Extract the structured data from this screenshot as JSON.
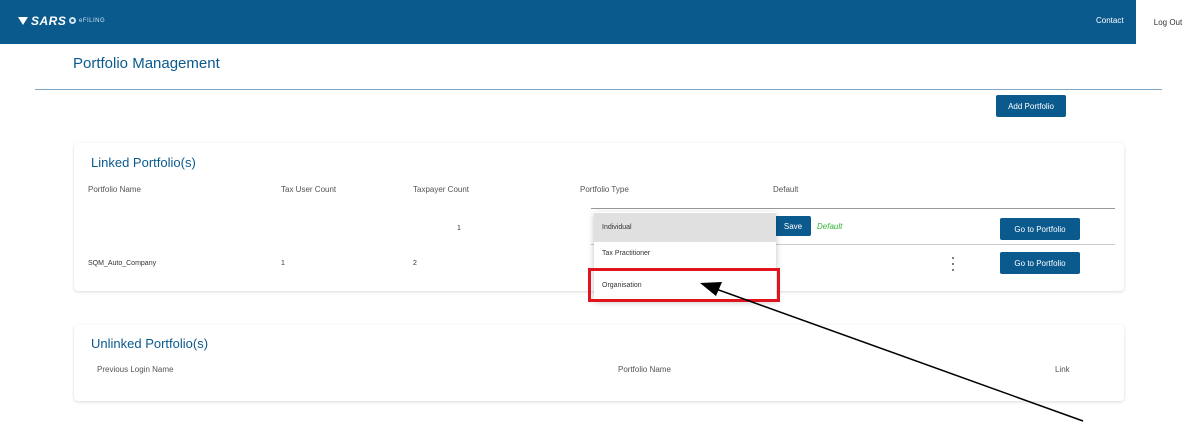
{
  "header": {
    "brand": "SARS",
    "product": "eFILING",
    "contact_label": "Contact",
    "logout_label": "Log Out"
  },
  "page": {
    "title": "Portfolio Management",
    "add_portfolio_label": "Add Portfolio"
  },
  "linked": {
    "title": "Linked Portfolio(s)",
    "columns": [
      "Portfolio Name",
      "Tax User Count",
      "Taxpayer Count",
      "Portfolio Type",
      "Default"
    ],
    "rows": [
      {
        "name": "",
        "tax_user_count": "",
        "taxpayer_count": "1",
        "save_label": "Save",
        "default_label": "Default",
        "goto_label": "Go to Portfolio"
      },
      {
        "name": "SQM_Auto_Company",
        "tax_user_count": "1",
        "taxpayer_count": "2",
        "goto_label": "Go to Portfolio"
      }
    ]
  },
  "portfolio_type_dropdown": {
    "options": [
      "Individual",
      "Tax Practitioner",
      "Organisation"
    ],
    "selected": "Individual"
  },
  "unlinked": {
    "title": "Unlinked Portfolio(s)",
    "columns": [
      "Previous Login Name",
      "Portfolio Name",
      "Link"
    ]
  },
  "colors": {
    "brand_blue": "#0b5a8e",
    "default_green": "#33b233",
    "highlight_red": "#e0141e"
  }
}
